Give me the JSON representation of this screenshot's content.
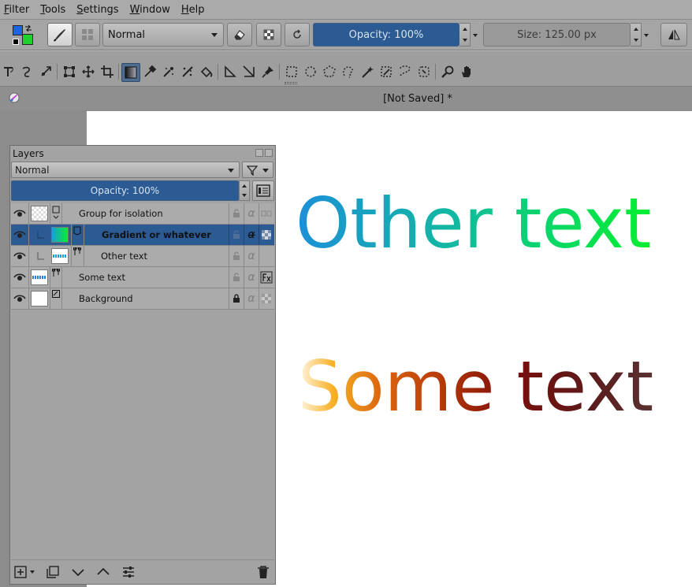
{
  "menu": [
    "Filter",
    "Tools",
    "Settings",
    "Window",
    "Help"
  ],
  "toolbar": {
    "blend_mode": "Normal",
    "opacity_label": "Opacity: 100%",
    "opacity_fraction": 1.0,
    "size_label": "Size: 125.00 px",
    "colors": {
      "foreground": "#1e63e0",
      "background": "#1fd12a"
    }
  },
  "document": {
    "title": "[Not Saved]  *"
  },
  "canvas": {
    "text_top": "Other text",
    "text_bottom": "Some text"
  },
  "layers_panel": {
    "title": "Layers",
    "blend_mode": "Normal",
    "opacity_label": "Opacity:  100%",
    "layers": [
      {
        "name": "Group for isolation",
        "indent": 0,
        "type": "group",
        "selected": false
      },
      {
        "name": "Gradient or whatever",
        "indent": 1,
        "type": "fill",
        "selected": true
      },
      {
        "name": "Other text",
        "indent": 1,
        "type": "vector",
        "selected": false
      },
      {
        "name": "Some text",
        "indent": 0,
        "type": "vector",
        "selected": false
      },
      {
        "name": "Background",
        "indent": 0,
        "type": "paint",
        "selected": false
      }
    ]
  }
}
